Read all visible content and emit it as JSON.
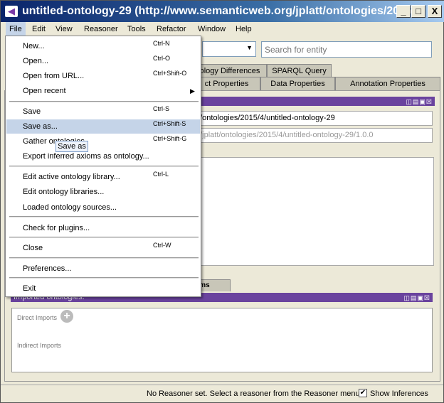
{
  "window": {
    "title": "untitled-ontology-29 (http://www.semanticweb.org/jplatt/ontologies/2015...",
    "minimize": "_",
    "maximize": "□",
    "close": "X"
  },
  "menubar": [
    "File",
    "Edit",
    "View",
    "Reasoner",
    "Tools",
    "Refactor",
    "Window",
    "Help"
  ],
  "search": {
    "placeholder": "Search for entity"
  },
  "tabs_row1": [
    "ology Differences",
    "SPARQL Query"
  ],
  "tabs_row2": [
    "ct Properties",
    "Data Properties",
    "Annotation Properties"
  ],
  "ontology": {
    "iri": "tt/ontologies/2015/4/untitled-ontology-29",
    "version_iri": "g/jplatt/ontologies/2015/4/untitled-ontology-29/1.0.0"
  },
  "lower_tab": "axioms",
  "imports": {
    "header": "Imported ontologies:",
    "direct": "Direct Imports",
    "indirect": "Indirect Imports"
  },
  "file_menu": [
    {
      "label": "New...",
      "shortcut": "Ctrl-N"
    },
    {
      "label": "Open...",
      "shortcut": "Ctrl-O"
    },
    {
      "label": "Open from URL...",
      "shortcut": "Ctrl+Shift-O"
    },
    {
      "label": "Open recent",
      "shortcut": "▶"
    },
    {
      "label": "Save",
      "shortcut": "Ctrl-S"
    },
    {
      "label": "Save as...",
      "shortcut": "Ctrl+Shift-S"
    },
    {
      "label": "Gather ontologies",
      "shortcut": "Ctrl+Shift-G"
    },
    {
      "label": "Export inferred axioms as ontology...",
      "shortcut": ""
    },
    {
      "label": "Edit active ontology library...",
      "shortcut": "Ctrl-L"
    },
    {
      "label": "Edit ontology libraries...",
      "shortcut": ""
    },
    {
      "label": "Loaded ontology sources...",
      "shortcut": ""
    },
    {
      "label": "Check for plugins...",
      "shortcut": ""
    },
    {
      "label": "Close",
      "shortcut": "Ctrl-W"
    },
    {
      "label": "Preferences...",
      "shortcut": ""
    },
    {
      "label": "Exit",
      "shortcut": ""
    }
  ],
  "tooltip": "Save as",
  "status": {
    "message": "No Reasoner set. Select a reasoner from the Reasoner menu",
    "show_inferences": "Show Inferences",
    "checked": true
  }
}
